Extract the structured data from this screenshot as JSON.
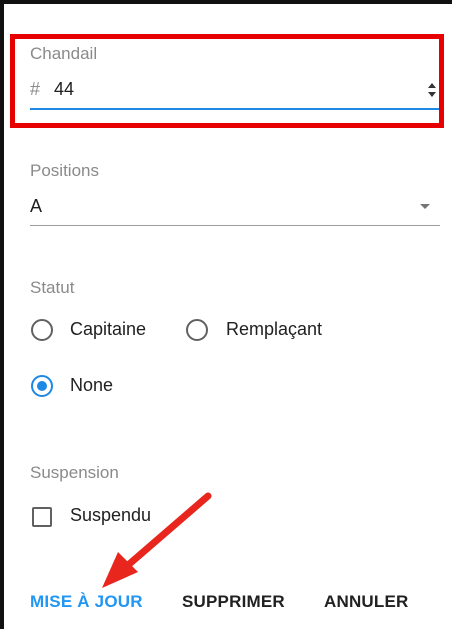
{
  "jersey": {
    "label": "Chandail",
    "prefix": "#",
    "value": "44"
  },
  "positions": {
    "label": "Positions",
    "selected": "A"
  },
  "status": {
    "label": "Statut",
    "options": [
      "Capitaine",
      "Remplaçant",
      "None"
    ],
    "selected": "None"
  },
  "suspension": {
    "label": "Suspension",
    "checkbox_label": "Suspendu",
    "checked": false
  },
  "actions": {
    "update": "MISE À JOUR",
    "delete": "SUPPRIMER",
    "cancel": "ANNULER"
  },
  "colors": {
    "accent": "#1e88e5",
    "highlight": "#e60000",
    "annotation_arrow": "#e8261e"
  }
}
